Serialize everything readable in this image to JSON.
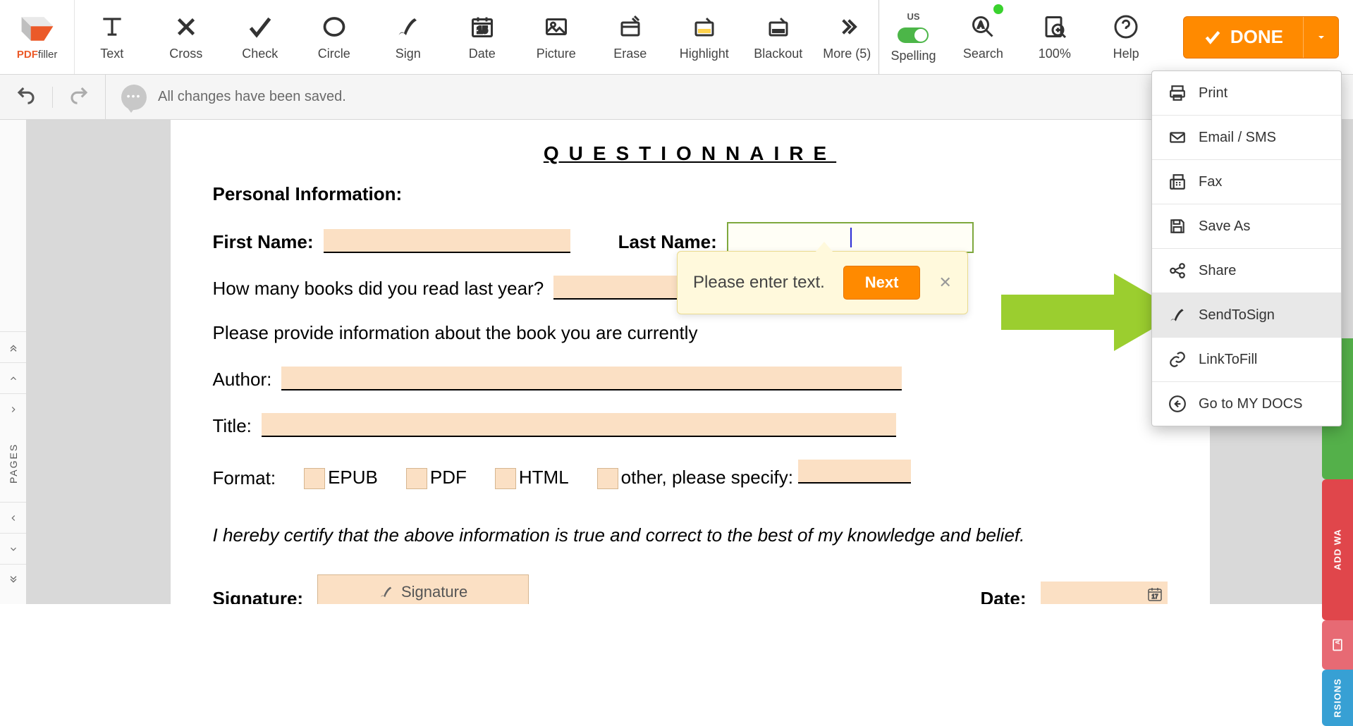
{
  "logo": {
    "pdf": "PDF",
    "filler": "filler"
  },
  "toolbar": {
    "text": "Text",
    "cross": "Cross",
    "check": "Check",
    "circle": "Circle",
    "sign": "Sign",
    "date": "Date",
    "picture": "Picture",
    "erase": "Erase",
    "highlight": "Highlight",
    "blackout": "Blackout",
    "more": "More (5)",
    "spelling_lang": "US",
    "spelling": "Spelling",
    "search": "Search",
    "zoom": "100%",
    "help": "Help",
    "done": "DONE"
  },
  "subbar": {
    "status": "All changes have been saved."
  },
  "left_rail": {
    "pages": "PAGES"
  },
  "document": {
    "title": "QUESTIONNAIRE",
    "section_personal": "Personal Information",
    "first_name_label": "First Name",
    "last_name_label": "Last Name",
    "books_question": "How many books did you read last year?",
    "current_book_prompt": "Please provide information about the book you are currently",
    "author_label": "Author:",
    "title_label": "Title:",
    "format_label": "Format:",
    "format_epub": "EPUB",
    "format_pdf": "PDF",
    "format_html": "HTML",
    "format_other": "other, please specify:",
    "certify": "I hereby certify that the above information is true and correct to the best of my knowledge and belief.",
    "signature_label": "Signature",
    "signature_placeholder": "Signature",
    "date_label": "Date"
  },
  "tooltip": {
    "text": "Please enter text.",
    "next": "Next"
  },
  "dropdown": {
    "print": "Print",
    "email": "Email / SMS",
    "fax": "Fax",
    "save_as": "Save As",
    "share": "Share",
    "send_to_sign": "SendToSign",
    "link_to_fill": "LinkToFill",
    "go_to_docs": "Go to MY DOCS"
  },
  "side": {
    "add": "ADD WA",
    "rsions": "RSIONS"
  }
}
